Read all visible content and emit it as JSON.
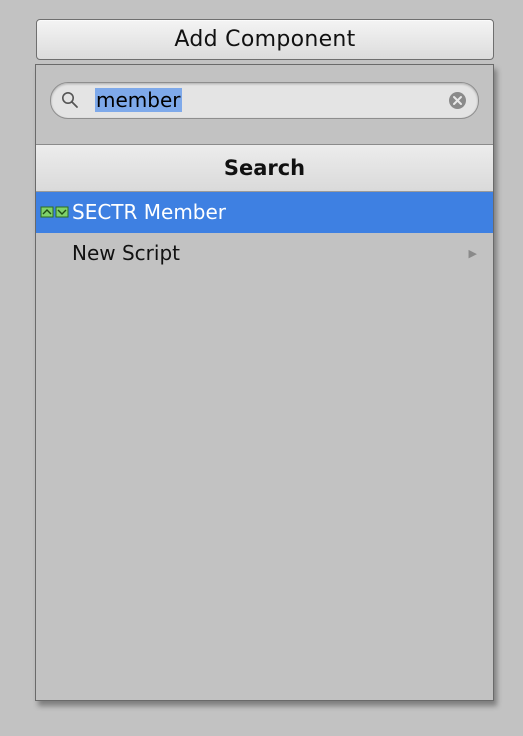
{
  "header": {
    "add_component_label": "Add Component"
  },
  "search": {
    "value": "member"
  },
  "section": {
    "title": "Search"
  },
  "results": [
    {
      "label": "SECTR Member",
      "icon": "script-component-icon",
      "selected": true
    },
    {
      "label": "New Script",
      "icon": "",
      "selected": false,
      "has_submenu": true
    }
  ],
  "colors": {
    "background": "#c2c2c2",
    "selection": "#3e80e2",
    "text_selection": "#7ea9ea",
    "icon_green": "#7fd16a"
  }
}
